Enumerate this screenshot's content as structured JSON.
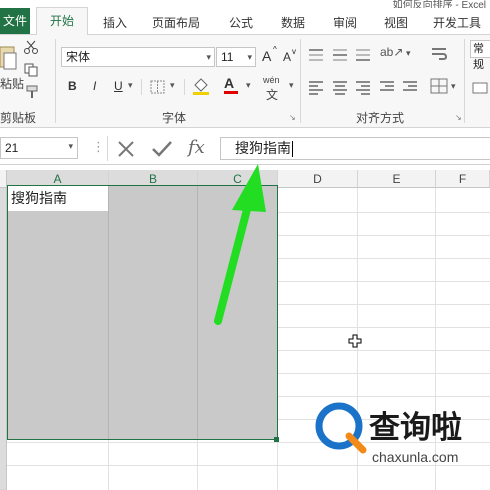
{
  "title": "如何反向排序 - Excel",
  "tabs": [
    "文件",
    "开始",
    "插入",
    "页面布局",
    "公式",
    "数据",
    "审阅",
    "视图",
    "开发工具"
  ],
  "ribbon": {
    "clipboard": {
      "paste_label": "粘贴",
      "group_label": "剪贴板"
    },
    "font": {
      "font_name": "宋体",
      "font_size": "11",
      "bold": "B",
      "italic": "I",
      "underline": "U",
      "grow": "A",
      "shrink": "A",
      "font_color_glyph": "A",
      "phonetic": "wén",
      "group_label": "字体"
    },
    "alignment": {
      "group_label": "对齐方式"
    },
    "number": {
      "format_label": "常规"
    }
  },
  "formula_bar": {
    "name_box": "21",
    "fx_label": "fx",
    "content": "搜狗指南"
  },
  "grid": {
    "columns": [
      "A",
      "B",
      "C",
      "D",
      "E",
      "F"
    ],
    "cell_a1": "搜狗指南"
  },
  "watermark": {
    "brand": "查询啦",
    "url": "chaxunla.com"
  },
  "colors": {
    "excel_green": "#217346",
    "selection_fill": "#c9c9c9",
    "arrow": "#22dd22"
  }
}
